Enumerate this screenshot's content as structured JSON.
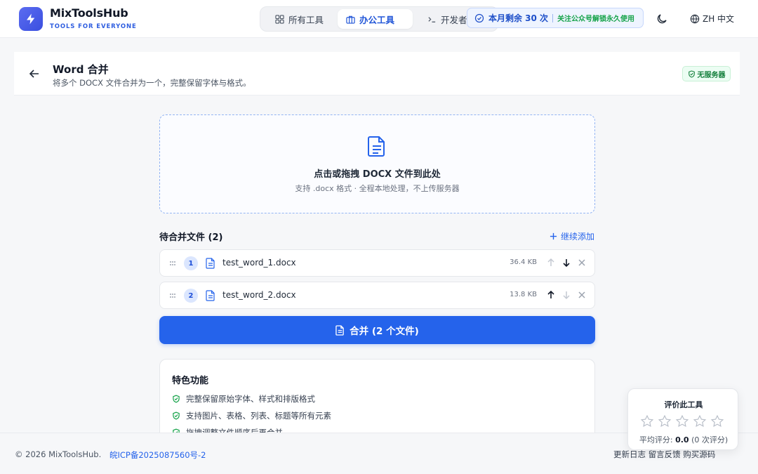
{
  "brand": {
    "name": "MixToolsHub",
    "tagline": "TOOLS FOR EVERYONE"
  },
  "nav": {
    "tabs": [
      {
        "label": "所有工具",
        "icon": "grid-icon"
      },
      {
        "label": "办公工具",
        "icon": "briefcase-icon",
        "active": true
      },
      {
        "label": "开发者",
        "icon": "terminal-icon"
      }
    ]
  },
  "usage": {
    "text": "本月剩余 30 次",
    "link": "关注公众号解锁永久使用"
  },
  "language": {
    "label": "ZH 中文"
  },
  "page": {
    "title": "Word 合并",
    "subtitle": "将多个 DOCX 文件合并为一个，完整保留字体与格式。",
    "badge": "无服务器"
  },
  "dropzone": {
    "title": "点击或拖拽 DOCX 文件到此处",
    "subtitle": "支持 .docx 格式 · 全程本地处理，不上传服务器"
  },
  "file_list": {
    "heading": "待合并文件 (2)",
    "add_more": "继续添加",
    "files": [
      {
        "index": "1",
        "name": "test_word_1.docx",
        "size": "36.4 KB"
      },
      {
        "index": "2",
        "name": "test_word_2.docx",
        "size": "13.8 KB"
      }
    ]
  },
  "merge_button": "合并 (2 个文件)",
  "features": {
    "title": "特色功能",
    "items": [
      "完整保留原始字体、样式和排版格式",
      "支持图片、表格、列表、标题等所有元素",
      "拖拽调整文件顺序后再合并"
    ]
  },
  "footer": {
    "copyright": "© 2026 MixToolsHub.",
    "icp": "皖ICP备2025087560号-2",
    "links": "更新日志   留言反馈   购买源码"
  },
  "rating": {
    "title": "评价此工具",
    "avg_label": "平均评分:",
    "avg_value": "0.0",
    "count": "(0 次评分)",
    "stars_filled": 0,
    "stars_total": 5
  },
  "colors": {
    "accent": "#2563eb",
    "success": "#16a34a"
  }
}
